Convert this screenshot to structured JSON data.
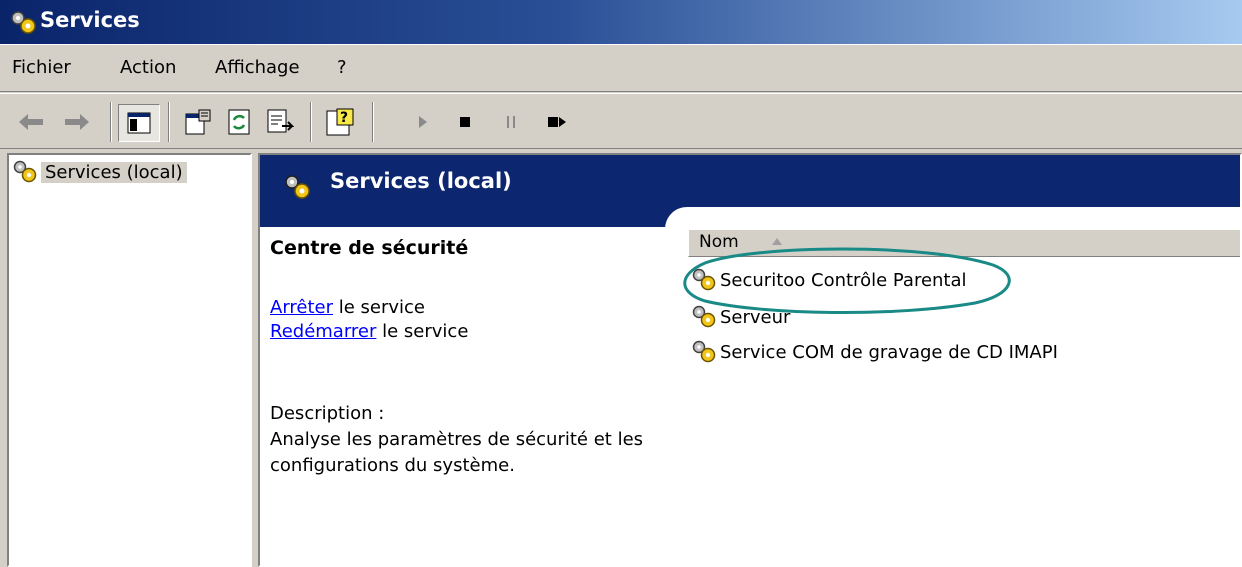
{
  "window": {
    "title": "Services"
  },
  "menu": {
    "items": [
      "Fichier",
      "Action",
      "Affichage",
      "?"
    ]
  },
  "toolbar": {
    "buttons": [
      "back-icon",
      "forward-icon",
      "show-hide-tree-icon",
      "properties-icon",
      "refresh-icon",
      "export-list-icon",
      "help-icon",
      "start-service-icon",
      "stop-service-icon",
      "pause-service-icon",
      "restart-service-icon"
    ]
  },
  "tree": {
    "root_label": "Services (local)"
  },
  "content": {
    "header_title": "Services (local)",
    "detail": {
      "service_name": "Centre de sécurité",
      "stop_link": "Arrêter",
      "stop_suffix": " le service",
      "restart_link": "Redémarrer",
      "restart_suffix": " le service",
      "description_label": "Description :",
      "description_text": "Analyse les paramètres de sécurité et les configurations du système."
    },
    "list": {
      "column_header": "Nom",
      "rows": [
        {
          "name": "Securitoo Contrôle Parental"
        },
        {
          "name": "Serveur"
        },
        {
          "name": "Service COM de gravage de CD IMAPI"
        }
      ]
    }
  },
  "colors": {
    "title_bar": "#0a246a",
    "content_header": "#0c2770",
    "link": "#0000ff",
    "highlight_ellipse": "#1a8a86",
    "window_bg": "#d4d0c8"
  }
}
